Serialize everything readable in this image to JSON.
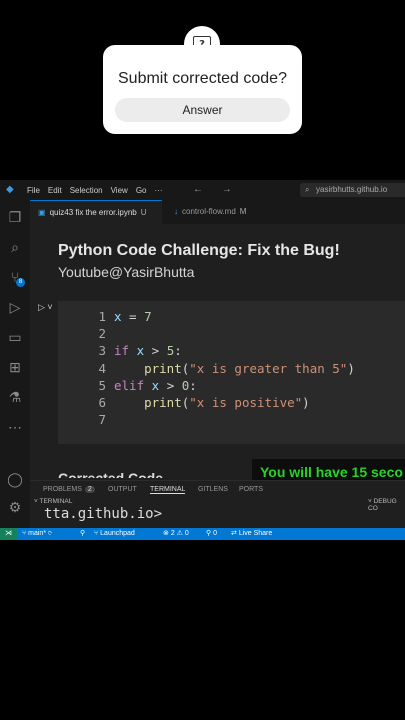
{
  "question": {
    "title": "Submit corrected code?",
    "answer_label": "Answer"
  },
  "titlebar": {
    "menu": [
      "File",
      "Edit",
      "Selection",
      "View",
      "Go",
      "···"
    ],
    "nav_arrows": "← →",
    "search": "yasirbhutts.github.io"
  },
  "tabs": [
    {
      "label": "quiz43 fix the error.ipynb",
      "flag": "U"
    },
    {
      "label": "control-flow.md",
      "flag": "M"
    }
  ],
  "markdown": {
    "title": "Python Code Challenge: Fix the Bug!",
    "subtitle": "Youtube@YasirBhutta"
  },
  "code_lines": [
    {
      "num": "1"
    },
    {
      "num": "2"
    },
    {
      "num": "3"
    },
    {
      "num": "4"
    },
    {
      "num": "5"
    },
    {
      "num": "6"
    },
    {
      "num": "7"
    }
  ],
  "code_tokens": {
    "l1_x": "x",
    "l1_eq": " = ",
    "l1_val": "7",
    "l3_kw": "if",
    "l3_x": " x",
    "l3_op": " > ",
    "l3_val": "5",
    "l3_colon": ":",
    "l4_fn": "print",
    "l4_open": "(",
    "l4_str": "\"x is greater than 5\"",
    "l4_close": ")",
    "l5_kw": "elif",
    "l5_x": " x",
    "l5_op": " > ",
    "l5_val": "0",
    "l5_colon": ":",
    "l6_fn": "print",
    "l6_open": "(",
    "l6_str": "\"x is positive\"",
    "l6_close": ")"
  },
  "partial_heading": "Corrected Code",
  "overlay_text": "You will have 15 seco",
  "panel": {
    "tabs": [
      "PROBLEMS",
      "OUTPUT",
      "TERMINAL",
      "GITLENS",
      "PORTS"
    ],
    "problems_count": "2",
    "terminal_header": "TERMINAL",
    "debug_header": "DEBUG CO",
    "terminal_text": "tta.github.io>"
  },
  "statusbar": {
    "branch": "main*",
    "launchpad": "Launchpad",
    "errors": "2",
    "warnings": "0",
    "ports": "0",
    "liveshare": "Live Share"
  },
  "colors": {
    "accent": "#0078d4",
    "overlay_green": "#28d228"
  }
}
